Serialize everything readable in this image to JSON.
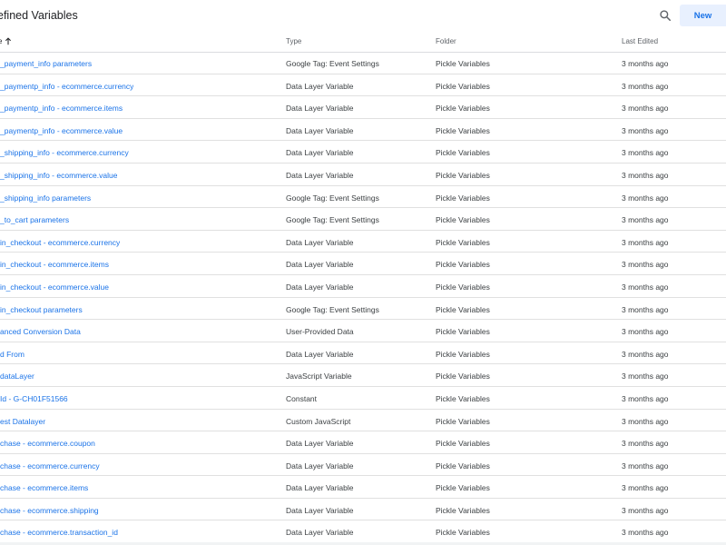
{
  "header": {
    "title": "efined Variables",
    "search_icon": "search-icon",
    "new_label": "New"
  },
  "columns": {
    "name": "e",
    "type": "Type",
    "folder": "Folder",
    "last_edited": "Last Edited"
  },
  "rows": [
    {
      "name": "_payment_info parameters",
      "type": "Google Tag: Event Settings",
      "folder": "Pickle Variables",
      "edited": "3 months ago"
    },
    {
      "name": "_paymentp_info - ecommerce.currency",
      "type": "Data Layer Variable",
      "folder": "Pickle Variables",
      "edited": "3 months ago"
    },
    {
      "name": "_paymentp_info - ecommerce.items",
      "type": "Data Layer Variable",
      "folder": "Pickle Variables",
      "edited": "3 months ago"
    },
    {
      "name": "_paymentp_info - ecommerce.value",
      "type": "Data Layer Variable",
      "folder": "Pickle Variables",
      "edited": "3 months ago"
    },
    {
      "name": "_shipping_info - ecommerce.currency",
      "type": "Data Layer Variable",
      "folder": "Pickle Variables",
      "edited": "3 months ago"
    },
    {
      "name": "_shipping_info - ecommerce.value",
      "type": "Data Layer Variable",
      "folder": "Pickle Variables",
      "edited": "3 months ago"
    },
    {
      "name": "_shipping_info parameters",
      "type": "Google Tag: Event Settings",
      "folder": "Pickle Variables",
      "edited": "3 months ago"
    },
    {
      "name": "_to_cart parameters",
      "type": "Google Tag: Event Settings",
      "folder": "Pickle Variables",
      "edited": "3 months ago"
    },
    {
      "name": "in_checkout - ecommerce.currency",
      "type": "Data Layer Variable",
      "folder": "Pickle Variables",
      "edited": "3 months ago"
    },
    {
      "name": "in_checkout - ecommerce.items",
      "type": "Data Layer Variable",
      "folder": "Pickle Variables",
      "edited": "3 months ago"
    },
    {
      "name": "in_checkout - ecommerce.value",
      "type": "Data Layer Variable",
      "folder": "Pickle Variables",
      "edited": "3 months ago"
    },
    {
      "name": "in_checkout parameters",
      "type": "Google Tag: Event Settings",
      "folder": "Pickle Variables",
      "edited": "3 months ago"
    },
    {
      "name": "anced Conversion Data",
      "type": "User-Provided Data",
      "folder": "Pickle Variables",
      "edited": "3 months ago"
    },
    {
      "name": "d From",
      "type": "Data Layer Variable",
      "folder": "Pickle Variables",
      "edited": "3 months ago"
    },
    {
      "name": "dataLayer",
      "type": "JavaScript Variable",
      "folder": "Pickle Variables",
      "edited": "3 months ago"
    },
    {
      "name": "Id - G-CH01F51566",
      "type": "Constant",
      "folder": "Pickle Variables",
      "edited": "3 months ago"
    },
    {
      "name": "est Datalayer",
      "type": "Custom JavaScript",
      "folder": "Pickle Variables",
      "edited": "3 months ago"
    },
    {
      "name": "chase - ecommerce.coupon",
      "type": "Data Layer Variable",
      "folder": "Pickle Variables",
      "edited": "3 months ago"
    },
    {
      "name": "chase - ecommerce.currency",
      "type": "Data Layer Variable",
      "folder": "Pickle Variables",
      "edited": "3 months ago"
    },
    {
      "name": "chase - ecommerce.items",
      "type": "Data Layer Variable",
      "folder": "Pickle Variables",
      "edited": "3 months ago"
    },
    {
      "name": "chase - ecommerce.shipping",
      "type": "Data Layer Variable",
      "folder": "Pickle Variables",
      "edited": "3 months ago"
    },
    {
      "name": "chase - ecommerce.transaction_id",
      "type": "Data Layer Variable",
      "folder": "Pickle Variables",
      "edited": "3 months ago"
    }
  ],
  "colors": {
    "link": "#1a73e8",
    "text": "#3c4043",
    "divider": "#e0e0e0",
    "new_button_bg": "#e8f0fe"
  }
}
